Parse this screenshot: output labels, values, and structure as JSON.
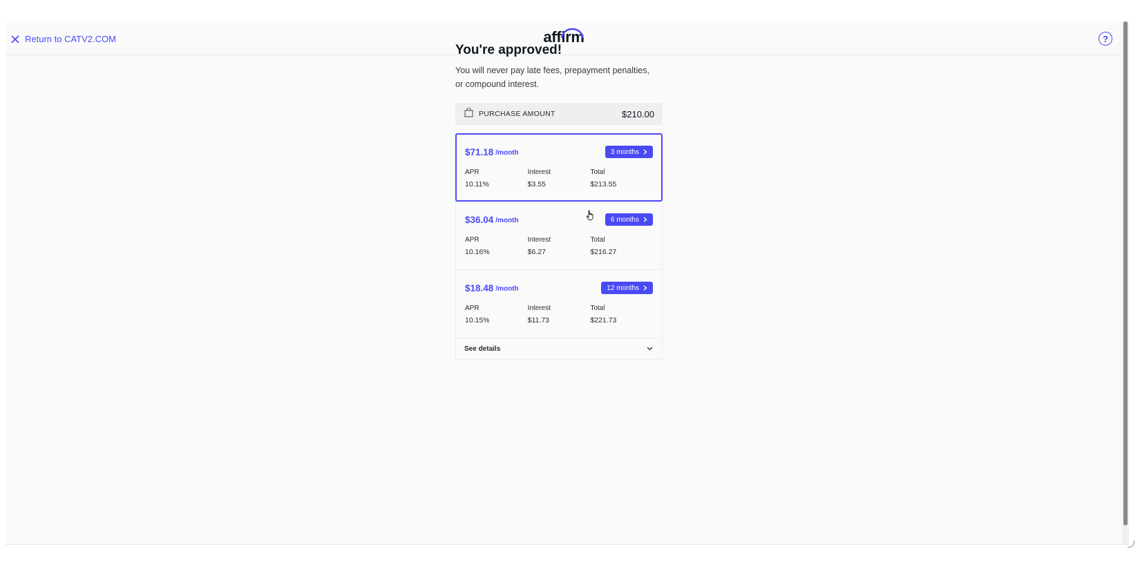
{
  "header": {
    "return_label": "Return to CATV2.COM",
    "logo_text": "affirm",
    "help_label": "?"
  },
  "main": {
    "title": "You're approved!",
    "subtitle": "You will never pay late fees, prepayment penalties, or compound interest.",
    "purchase": {
      "label": "PURCHASE AMOUNT",
      "amount": "$210.00"
    },
    "plans": [
      {
        "price": "$71.18",
        "per": "/month",
        "term": "3 months",
        "apr_label": "APR",
        "apr": "10.11%",
        "interest_label": "Interest",
        "interest": "$3.55",
        "total_label": "Total",
        "total": "$213.55",
        "selected": true
      },
      {
        "price": "$36.04",
        "per": "/month",
        "term": "6 months",
        "apr_label": "APR",
        "apr": "10.16%",
        "interest_label": "Interest",
        "interest": "$6.27",
        "total_label": "Total",
        "total": "$216.27",
        "selected": false
      },
      {
        "price": "$18.48",
        "per": "/month",
        "term": "12 months",
        "apr_label": "APR",
        "apr": "10.15%",
        "interest_label": "Interest",
        "interest": "$11.73",
        "total_label": "Total",
        "total": "$221.73",
        "selected": false
      }
    ],
    "details_label": "See details"
  },
  "colors": {
    "accent": "#4a4af4",
    "background": "#fafafa",
    "text": "#101820"
  },
  "icons": [
    "close-icon",
    "shopping-bag-icon",
    "chevron-right-icon",
    "chevron-down-icon",
    "help-icon",
    "hand-cursor-icon"
  ]
}
